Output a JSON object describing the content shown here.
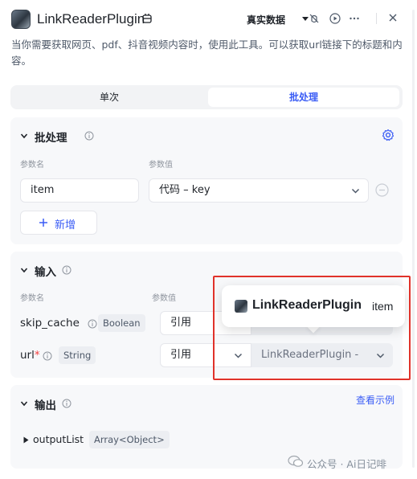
{
  "header": {
    "title": "LinkReaderPlugin",
    "env_label": "真实数据",
    "icons": [
      "bug-off-icon",
      "play-icon",
      "more-icon",
      "close-icon"
    ]
  },
  "description": "当你需要获取网页、pdf、抖音视频内容时，使用此工具。可以获取url链接下的标题和内容。",
  "tabs": [
    {
      "label": "单次",
      "active": false
    },
    {
      "label": "批处理",
      "active": true
    }
  ],
  "batch": {
    "title": "批处理",
    "col_name": "参数名",
    "col_value": "参数值",
    "row": {
      "name": "item",
      "value": "代码 – key"
    },
    "add_label": "新增"
  },
  "input": {
    "title": "输入",
    "col_name": "参数名",
    "col_value": "参数值",
    "params": [
      {
        "name": "skip_cache",
        "type": "Boolean",
        "mode": "引用",
        "value": ""
      },
      {
        "name": "url",
        "required_mark": "*",
        "type": "String",
        "mode": "引用",
        "value": "LinkReaderPlugin -"
      }
    ]
  },
  "output": {
    "title": "输出",
    "example_link": "查看示例",
    "items": [
      {
        "name": "outputList",
        "type": "Array<Object>"
      }
    ]
  },
  "popover": {
    "plugin": "LinkReaderPlugin",
    "field": "item"
  },
  "watermark": "公众号 · Ai日记啡",
  "colors": {
    "accent": "#3a5cf5",
    "highlight": "#e0322a",
    "required": "#f53f3f"
  }
}
